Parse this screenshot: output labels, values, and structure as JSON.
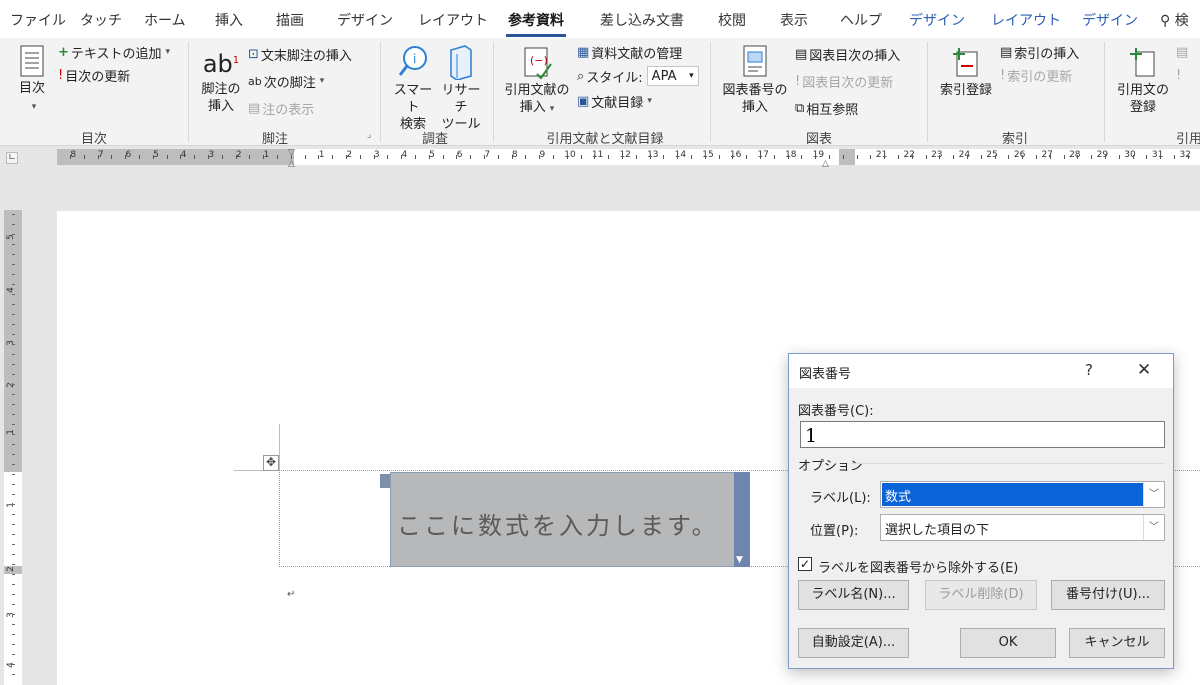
{
  "ribbon_tabs": [
    "ファイル",
    "タッチ",
    "ホーム",
    "挿入",
    "描画",
    "デザイン",
    "レイアウト",
    "参考資料",
    "差し込み文書",
    "校閲",
    "表示",
    "ヘルプ",
    "デザイン",
    "レイアウト",
    "デザイン",
    "検"
  ],
  "ribbon": {
    "toc": {
      "button": "目次",
      "add_text": "テキストの追加",
      "update": "目次の更新",
      "group": "目次"
    },
    "footnotes": {
      "insert_footnote": "脚注の\n挿入",
      "insert_endnote": "文末脚注の挿入",
      "next_footnote": "次の脚注",
      "show_notes": "注の表示",
      "group": "脚注"
    },
    "research": {
      "smart_lookup": "スマート\n検索",
      "researcher": "リサーチ\nツール",
      "group": "調査"
    },
    "citations": {
      "insert_citation": "引用文献の\n挿入",
      "manage_sources": "資料文献の管理",
      "style_label": "スタイル:",
      "style_value": "APA",
      "bibliography": "文献目録",
      "group": "引用文献と文献目録"
    },
    "captions": {
      "insert_caption": "図表番号の\n挿入",
      "insert_table_of_figures": "図表目次の挿入",
      "update_table": "図表目次の更新",
      "cross_reference": "相互参照",
      "group": "図表"
    },
    "index": {
      "mark_entry": "索引登録",
      "insert_index": "索引の挿入",
      "update_index": "索引の更新",
      "group": "索引"
    },
    "authorities": {
      "mark_citation": "引用文の\n登録",
      "group": "引用"
    }
  },
  "ruler": {
    "left_numbers": [
      "8",
      "7",
      "6",
      "5",
      "4",
      "3",
      "2",
      "1"
    ],
    "right_numbers": [
      "1",
      "2",
      "3",
      "4",
      "5",
      "6",
      "7",
      "8",
      "9",
      "10",
      "11",
      "12",
      "13",
      "14",
      "15",
      "16",
      "17",
      "18",
      "19",
      "21",
      "22",
      "23",
      "24",
      "25",
      "26",
      "27",
      "28",
      "29",
      "30",
      "31",
      "32"
    ],
    "vertical_numbers": [
      "5",
      "4",
      "3",
      "2",
      "1",
      "1",
      "2",
      "3",
      "4"
    ]
  },
  "document": {
    "equation_placeholder": "ここに数式を入力します。"
  },
  "dialog": {
    "title": "図表番号",
    "help": "?",
    "close": "✕",
    "caption_label": "図表番号(C):",
    "caption_value": "1",
    "options_label": "オプション",
    "label_label": "ラベル(L):",
    "label_value": "数式",
    "position_label": "位置(P):",
    "position_value": "選択した項目の下",
    "exclude_label": "ラベルを図表番号から除外する(E)",
    "exclude_checked": true,
    "new_label_button": "ラベル名(N)...",
    "delete_label_button": "ラベル削除(D)",
    "numbering_button": "番号付け(U)...",
    "autocaption_button": "自動設定(A)...",
    "ok_button": "OK",
    "cancel_button": "キャンセル"
  },
  "colors": {
    "accent": "#2b579a",
    "selection": "#0a64d8",
    "contextual_tab": "#2b5fb4"
  }
}
